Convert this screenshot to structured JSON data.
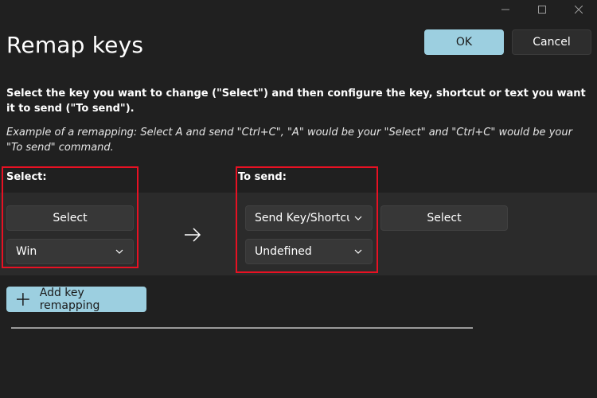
{
  "window": {
    "minimize_glyph": "—",
    "maximize_glyph": "☐",
    "close_glyph": "✕"
  },
  "header": {
    "title": "Remap keys",
    "ok_label": "OK",
    "cancel_label": "Cancel"
  },
  "description": "Select the key you want to change (\"Select\") and then configure the key, shortcut or text you want it to send (\"To send\").",
  "example": "Example of a remapping: Select A and send \"Ctrl+C\", \"A\" would be your \"Select\" and \"Ctrl+C\" would be your \"To send\" command.",
  "select_column": {
    "label": "Select:",
    "select_button": "Select",
    "key_dropdown": "Win"
  },
  "to_send_column": {
    "label": "To send:",
    "type_dropdown": "Send Key/Shortcu",
    "select_button": "Select",
    "key_dropdown": "Undefined"
  },
  "add_button_label": "Add key remapping",
  "colors": {
    "background": "#202020",
    "accent": "#9ccfe0",
    "highlight": "#e81123"
  }
}
